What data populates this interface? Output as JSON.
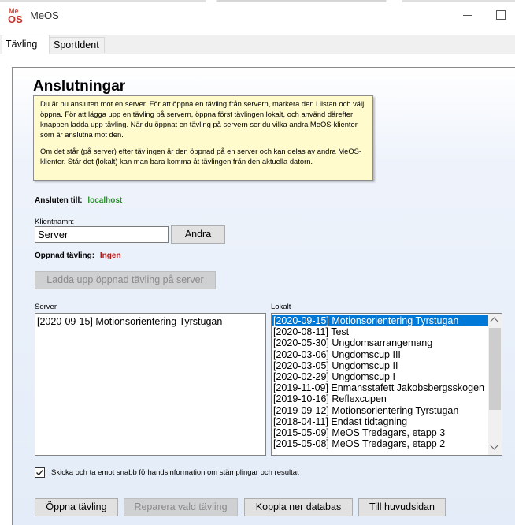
{
  "window": {
    "title": "MeOS"
  },
  "tabs": [
    {
      "label": "Tävling"
    },
    {
      "label": "SportIdent"
    }
  ],
  "page": {
    "title": "Anslutningar",
    "info_paragraphs": [
      "Du är nu ansluten mot en server. För att öppna en tävling från servern, markera den i listan och välj öppna. För att lägga upp en tävling på servern, öppna först tävlingen lokalt, och använd därefter knappen ladda upp tävling. När du öppnat en tävling på servern ser du vilka andra MeOS-klienter som är anslutna mot den.",
      "Om det står (på server) efter tävlingen är den öppnad på en server och kan delas av andra MeOS-klienter. Står det (lokalt) kan man bara komma åt tävlingen från den aktuella datorn."
    ],
    "connected_label": "Ansluten till:",
    "connected_value": "localhost",
    "client_name_label": "Klientnamn:",
    "client_name_value": "Server",
    "change_button": "Ändra",
    "opened_label": "Öppnad tävling:",
    "opened_value": "Ingen",
    "upload_button": "Ladda upp öppnad tävling på server",
    "server_label": "Server",
    "local_label": "Lokalt",
    "server_items": [
      "[2020-09-15] Motionsorientering Tyrstugan"
    ],
    "local_items": [
      "[2020-09-15] Motionsorientering Tyrstugan",
      "[2020-08-11] Test",
      "[2020-05-30] Ungdomsarrangemang",
      "[2020-03-06] Ungdomscup III",
      "[2020-03-05] Ungdomscup II",
      "[2020-02-29] Ungdomscup I",
      "[2019-11-09] Enmansstafett Jakobsbergsskogen",
      "[2019-10-16] Reflexcupen",
      "[2019-09-12] Motionsorientering Tyrstugan",
      "[2018-04-11] Endast tidtagning",
      "[2015-05-09] MeOS Tredagars, etapp 3",
      "[2015-05-08] MeOS Tredagars, etapp 2"
    ],
    "fast_info_label": "Skicka och ta emot snabb förhandsinformation om stämplingar och resultat",
    "fast_info_checked": true,
    "buttons": {
      "open": "Öppna tävling",
      "repair": "Reparera vald tävling",
      "disconnect": "Koppla ner databas",
      "home": "Till huvudsidan"
    }
  },
  "colors": {
    "connected": "#2a8f2a",
    "opened": "#b01818",
    "selection": "#0078d7",
    "info_bg": "#fffbcc"
  }
}
